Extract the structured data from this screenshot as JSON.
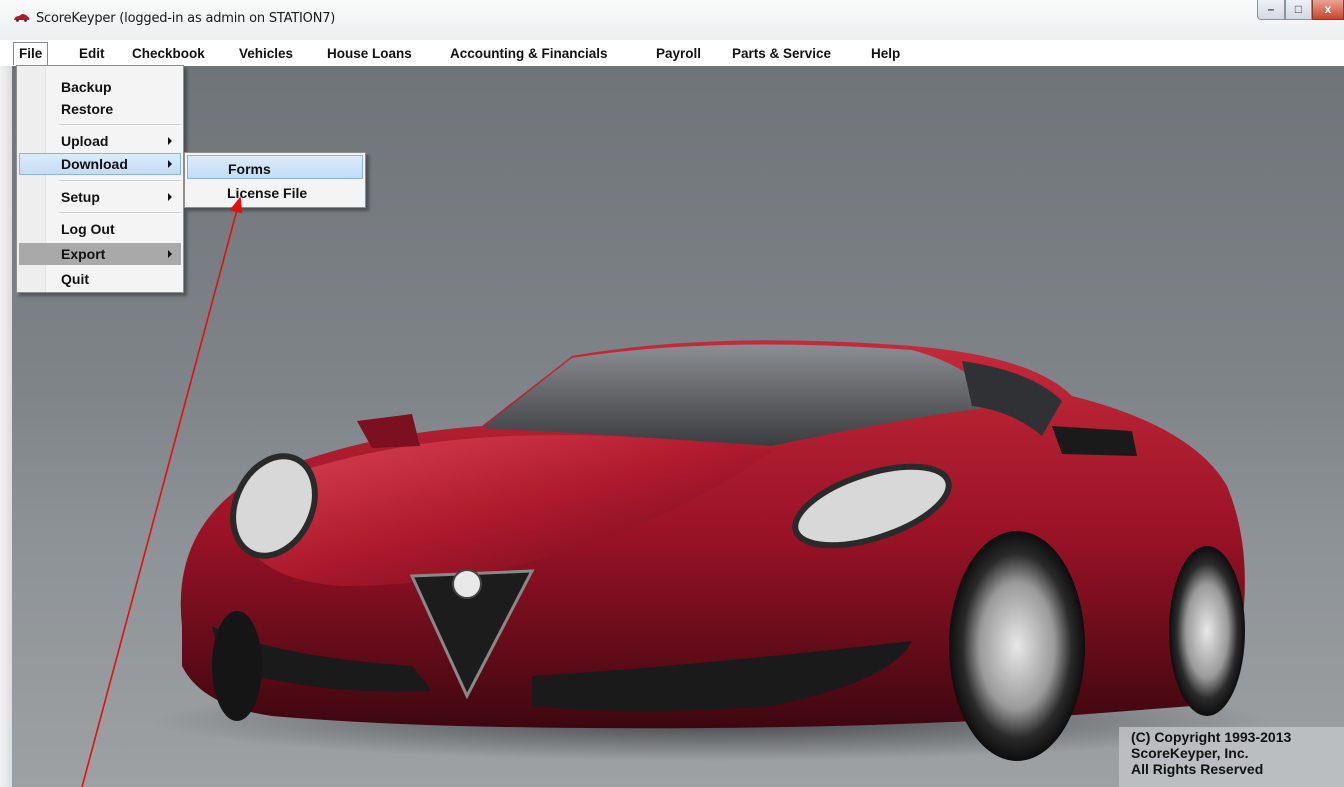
{
  "window": {
    "title": "ScoreKeyper  (logged-in as admin on STATION7)",
    "controls": {
      "minimize": "–",
      "maximize": "□",
      "close": "x"
    }
  },
  "menubar": {
    "items": [
      "File",
      "Edit",
      "Checkbook",
      "Vehicles",
      "House Loans",
      "Accounting & Financials",
      "Payroll",
      "Parts & Service",
      "Help"
    ],
    "open": "File"
  },
  "file_menu": {
    "items": [
      {
        "label": "Backup"
      },
      {
        "label": "Restore"
      },
      {
        "label": "Upload",
        "submenu": true
      },
      {
        "label": "Download",
        "submenu": true,
        "highlighted": true
      },
      {
        "label": "Setup",
        "submenu": true
      },
      {
        "label": "Log Out"
      },
      {
        "label": "Export",
        "submenu": true
      },
      {
        "label": "Quit"
      }
    ]
  },
  "download_submenu": {
    "items": [
      {
        "label": "Forms",
        "highlighted": true
      },
      {
        "label": "License File"
      }
    ]
  },
  "copyright": {
    "line1": "(C) Copyright 1993-2013",
    "line2": "ScoreKeyper, Inc.",
    "line3": "All Rights Reserved"
  },
  "background_image": "red sports car",
  "colors": {
    "highlight": "#c9e0f8",
    "annotation_arrow": "#e01010",
    "car_red": "#b0182c"
  }
}
